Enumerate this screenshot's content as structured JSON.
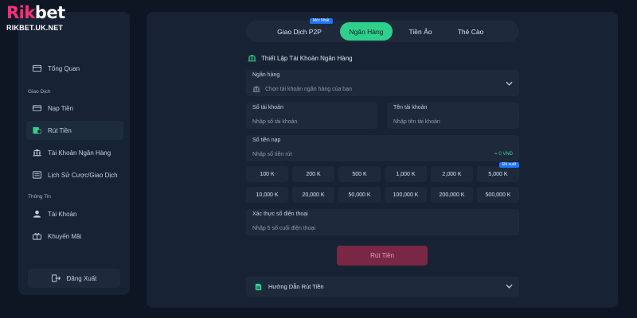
{
  "brand": {
    "logo_part1": "Rik",
    "logo_part2": "bet",
    "site": "RIKBET.UK.NET",
    "accent_color": "#ff2f7a"
  },
  "sidebar": {
    "overview": {
      "label": "Tổng Quan",
      "icon": "wallet-icon"
    },
    "transactions_heading": "Giao Dịch",
    "transactions": [
      {
        "label": "Nạp Tiền",
        "icon": "deposit-card-icon"
      },
      {
        "label": "Rút Tiền",
        "icon": "withdraw-money-icon",
        "active": true
      },
      {
        "label": "Tài Khoản Ngân Hàng",
        "icon": "bank-icon"
      },
      {
        "label": "Lịch Sử Cược/Giao Dịch",
        "icon": "history-icon"
      }
    ],
    "info_heading": "Thông Tin",
    "info": [
      {
        "label": "Tài Khoản",
        "icon": "user-icon"
      },
      {
        "label": "Khuyến Mãi",
        "icon": "gift-icon"
      }
    ],
    "logout_label": "Đăng Xuất"
  },
  "tabs": [
    {
      "label": "Giao Dịch P2P",
      "badge": "Mới Nhất"
    },
    {
      "label": "Ngân Hàng",
      "active": true
    },
    {
      "label": "Tiền Ảo"
    },
    {
      "label": "Thẻ Cào"
    }
  ],
  "form": {
    "section_title": "Thiết Lập Tài Khoản Ngân Hàng",
    "bank_label": "Ngân hàng",
    "bank_placeholder": "Chọn tài khoản ngân hàng của bạn",
    "account_number_label": "Số tài khoản",
    "account_number_placeholder": "Nhập số tài khoản",
    "account_name_label": "Tên tài khoản",
    "account_name_placeholder": "Nhập tên tài khoản",
    "amount_label": "Số tiền nạp",
    "amount_placeholder": "Nhập số tiền rút",
    "amount_hint": "= 0 VNĐ",
    "quick_amounts": [
      "100 K",
      "200 K",
      "500 K",
      "1,000 K",
      "2,000 K",
      "5,000 K",
      "10,000 K",
      "20,000 K",
      "50,000 K",
      "100,000 K",
      "200,000 K",
      "500,000 K"
    ],
    "quick_amount_badge": "Đề xuất",
    "phone_label": "Xác thực số điện thoại",
    "phone_placeholder": "Nhập 5 số cuối điện thoại",
    "submit_label": "Rút Tiền",
    "guide_label": "Hướng Dẫn Rút Tiền"
  },
  "colors": {
    "background": "#0e1624",
    "panel": "#172234",
    "field": "#1e2a3c",
    "accent_green": "#2fd08c",
    "submit_disabled": "#7a2745",
    "badge_blue": "#1e73ff"
  }
}
